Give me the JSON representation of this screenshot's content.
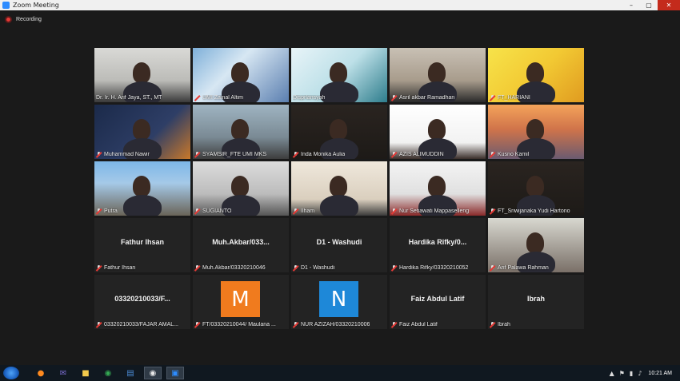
{
  "window": {
    "title": "Zoom Meeting",
    "buttons": {
      "minimize": "–",
      "maximize": "▢",
      "close": "✕"
    }
  },
  "recording": {
    "label": "Recording"
  },
  "participants": [
    {
      "name": "Dr. Ir. H. Arif Jaya, ST., MT",
      "video": "bg-office",
      "active": true,
      "muted": false
    },
    {
      "name": "UMI Zainal Altim",
      "video": "bg-poster",
      "muted": true
    },
    {
      "name": "Disprlansyah",
      "video": "bg-slide",
      "muted": false
    },
    {
      "name": "Asril akbar Ramadhan",
      "video": "bg-room",
      "muted": true
    },
    {
      "name": "FT_HARIANI",
      "video": "bg-yellow",
      "muted": true
    },
    {
      "name": "Muhammad Nawir",
      "video": "bg-navy",
      "muted": true
    },
    {
      "name": "SYAMSIR_FTE UMI MKS",
      "video": "bg-cafe",
      "muted": true
    },
    {
      "name": "Inda Monika Aulia",
      "video": "bg-dark",
      "muted": true
    },
    {
      "name": "AZIS ALIMUDDIN",
      "video": "bg-white",
      "muted": true
    },
    {
      "name": "Kusno Kamil",
      "video": "bg-bridge",
      "muted": true
    },
    {
      "name": "Putra",
      "video": "bg-gate",
      "muted": true
    },
    {
      "name": "SUGIANTO",
      "video": "bg-gray",
      "muted": true
    },
    {
      "name": "Ilham",
      "video": "bg-beige",
      "muted": true
    },
    {
      "name": "Nur Setiawati Mappaselleng",
      "video": "bg-pic",
      "muted": true
    },
    {
      "name": "FT_Sriwijanaka Yudi Hartono",
      "video": "bg-dark",
      "muted": true
    },
    {
      "name": "Fathur Ihsan",
      "bigname": "Fathur Ihsan",
      "muted": true
    },
    {
      "name": "Muh.Akbar/03320210046",
      "bigname": "Muh.Akbar/033...",
      "muted": true
    },
    {
      "name": "D1 - Washudi",
      "bigname": "D1 - Washudi",
      "muted": true
    },
    {
      "name": "Hardika Rifky/03320210052",
      "bigname": "Hardika  Rifky/0...",
      "muted": true
    },
    {
      "name": "Arif Palawa Rahman",
      "video": "bg-portrait",
      "photo": true,
      "muted": true
    },
    {
      "name": "03320210033/FAJAR AMAL...",
      "bigname": "03320210033/F...",
      "muted": true
    },
    {
      "name": "FT/03320210044/ Maulana ...",
      "avatar": "M",
      "avatar_color": "#f07b1e",
      "muted": true
    },
    {
      "name": "NUR AZIZAH/03320210006",
      "avatar": "N",
      "avatar_color": "#1e88d8",
      "muted": true
    },
    {
      "name": "Faiz Abdul Latif",
      "bigname": "Faiz Abdul Latif",
      "muted": true
    },
    {
      "name": "Ibrah",
      "bigname": "Ibrah",
      "muted": true
    }
  ],
  "taskbar": {
    "apps": [
      {
        "icon": "firefox-icon",
        "glyph": "●",
        "color": "#ff8a1f"
      },
      {
        "icon": "mail-icon",
        "glyph": "✉",
        "color": "#7a6ccf"
      },
      {
        "icon": "folder-icon",
        "glyph": "■",
        "color": "#f2c94c"
      },
      {
        "icon": "chrome-icon",
        "glyph": "◉",
        "color": "#34a853"
      },
      {
        "icon": "document-icon",
        "glyph": "▤",
        "color": "#4b8bd6"
      },
      {
        "icon": "chrome-window-icon",
        "glyph": "◉",
        "color": "#e8e8e8",
        "running": true
      },
      {
        "icon": "zoom-icon",
        "glyph": "▣",
        "color": "#2d8cff",
        "running": true
      }
    ],
    "tray": {
      "chevron": "▲",
      "flag": "⚑",
      "network": "▮",
      "volume": "♪",
      "clock": "10:21 AM"
    }
  }
}
